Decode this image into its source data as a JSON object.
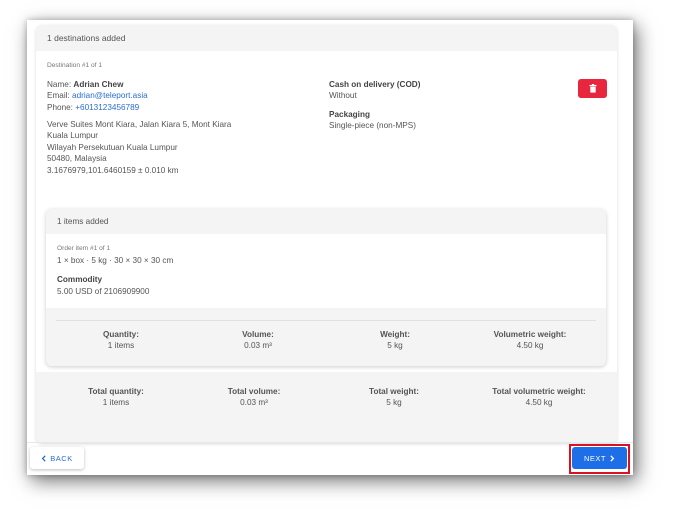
{
  "destinations": {
    "count_label": "1 destinations added",
    "destination_index": "Destination #1 of 1",
    "name_label": "Name:",
    "name": "Adrian Chew",
    "email_label": "Email:",
    "email": "adrian@teleport.asia",
    "phone_label": "Phone:",
    "phone": "+6013123456789",
    "address": [
      "Verve Suites Mont Kiara, Jalan Kiara 5, Mont Kiara",
      "Kuala Lumpur",
      "Wilayah Persekutuan Kuala Lumpur",
      "50480, Malaysia",
      "3.1676979,101.6460159 ± 0.010 km"
    ],
    "cod_label": "Cash on delivery (COD)",
    "cod_value": "Without",
    "packaging_label": "Packaging",
    "packaging_value": "Single-piece (non-MPS)",
    "delete_icon": "trash-icon"
  },
  "items": {
    "count_label": "1 items added",
    "order_index": "Order item #1 of 1",
    "description": "1 × box · 5 kg · 30 × 30 × 30 cm",
    "commodity_label": "Commodity",
    "commodity_value": "5.00 USD of 2106909900",
    "summary": [
      {
        "label": "Quantity:",
        "value": "1 items"
      },
      {
        "label": "Volume:",
        "value": "0.03 m³"
      },
      {
        "label": "Weight:",
        "value": "5 kg"
      },
      {
        "label": "Volumetric weight:",
        "value": "4.50 kg"
      }
    ]
  },
  "totals": [
    {
      "label": "Total quantity:",
      "value": "1 items"
    },
    {
      "label": "Total volume:",
      "value": "0.03 m³"
    },
    {
      "label": "Total weight:",
      "value": "5 kg"
    },
    {
      "label": "Total volumetric weight:",
      "value": "4.50 kg"
    }
  ],
  "footer": {
    "back_label": "BACK",
    "next_label": "NEXT",
    "back_icon": "chevron-left-icon",
    "next_icon": "chevron-right-icon"
  },
  "colors": {
    "accent": "#1e6ee8",
    "danger": "#e8263e",
    "highlight": "#d81222",
    "link": "#2a6ed3"
  }
}
